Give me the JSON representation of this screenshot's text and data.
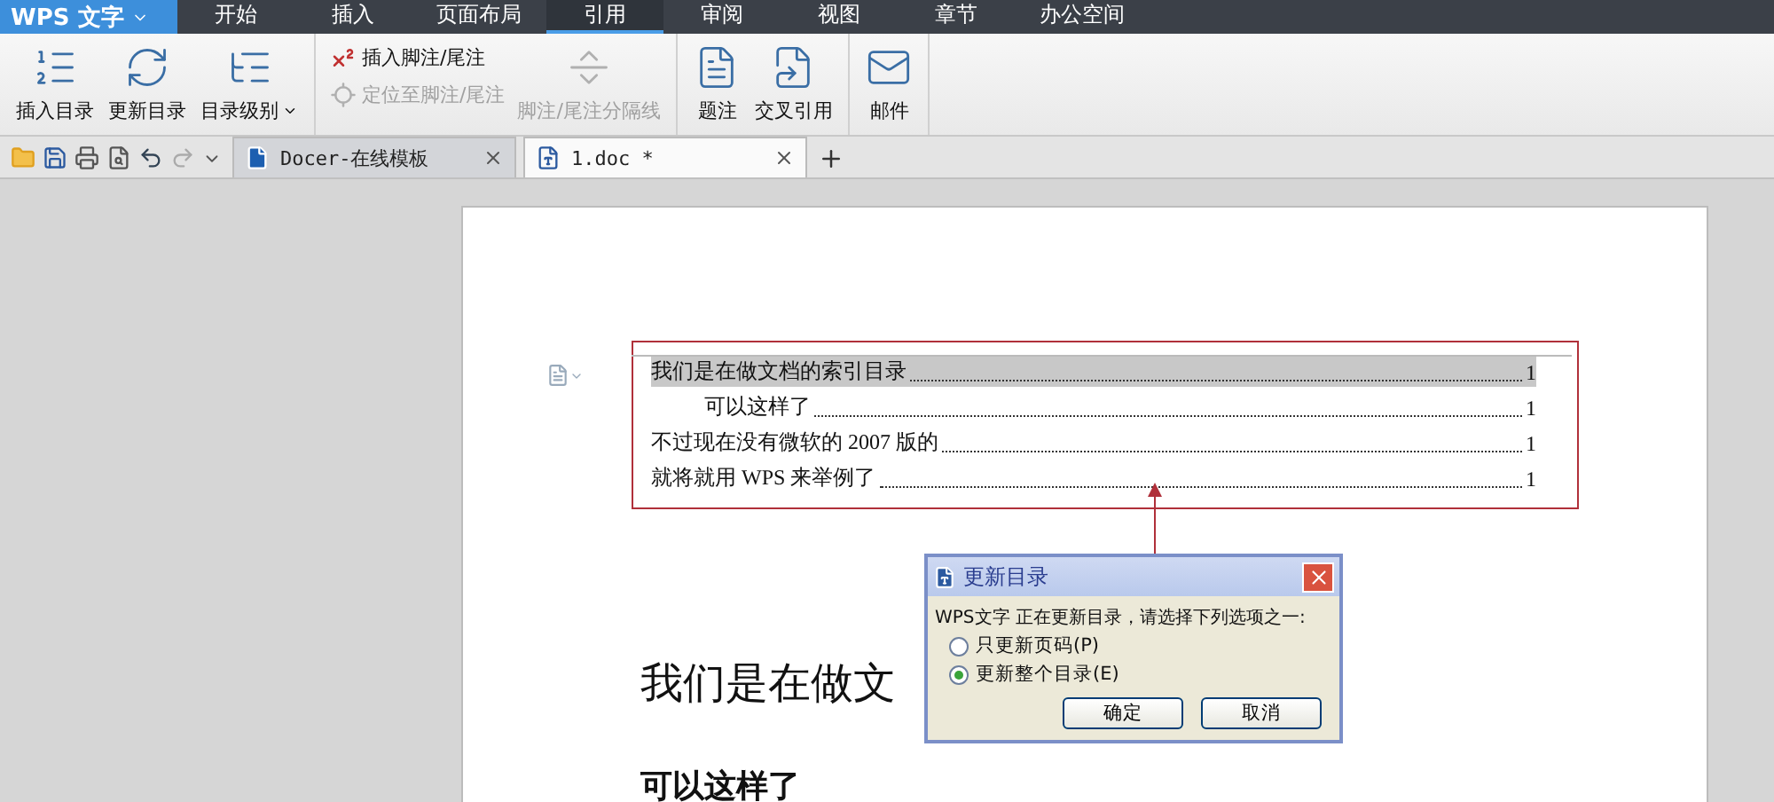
{
  "app_menu": {
    "title": "WPS 文字"
  },
  "menu_tabs": [
    {
      "label": "开始",
      "selected": false
    },
    {
      "label": "插入",
      "selected": false
    },
    {
      "label": "页面布局",
      "selected": false
    },
    {
      "label": "引用",
      "selected": true
    },
    {
      "label": "审阅",
      "selected": false
    },
    {
      "label": "视图",
      "selected": false
    },
    {
      "label": "章节",
      "selected": false
    },
    {
      "label": "办公空间",
      "selected": false
    }
  ],
  "ribbon_groups": [
    {
      "items": [
        {
          "kind": "large",
          "label": "插入目录",
          "disabled": false,
          "dropdown": false
        },
        {
          "kind": "large",
          "label": "更新目录",
          "disabled": false,
          "dropdown": false
        },
        {
          "kind": "large",
          "label": "目录级别",
          "disabled": false,
          "dropdown": true
        }
      ]
    },
    {
      "items": [
        {
          "kind": "small",
          "label": "插入脚注/尾注",
          "disabled": false,
          "dropdown": false
        },
        {
          "kind": "small",
          "label": "定位至脚注/尾注",
          "disabled": true,
          "dropdown": false
        },
        {
          "kind": "large",
          "label": "脚注/尾注分隔线",
          "disabled": true,
          "dropdown": false
        }
      ]
    },
    {
      "items": [
        {
          "kind": "large",
          "label": "题注",
          "disabled": false,
          "dropdown": false
        },
        {
          "kind": "large",
          "label": "交叉引用",
          "disabled": false,
          "dropdown": false
        }
      ]
    },
    {
      "items": [
        {
          "kind": "large",
          "label": "邮件",
          "disabled": false,
          "dropdown": false
        }
      ]
    }
  ],
  "doc_tabs": [
    {
      "label": "Docer-在线模板",
      "selected": false
    },
    {
      "label": "1.doc *",
      "selected": true
    }
  ],
  "toc": [
    {
      "text": "我们是在做文档的索引目录",
      "page": "1",
      "highlighted": true,
      "children": [
        {
          "text": "可以这样了",
          "page": "1",
          "highlighted": false
        }
      ]
    },
    {
      "text": "不过现在没有微软的 2007 版的",
      "page": "1",
      "highlighted": false
    },
    {
      "text": "就将就用 WPS 来举例了",
      "page": "1",
      "highlighted": false
    }
  ],
  "body_headings": [
    "我们是在做文",
    "可以这样了"
  ],
  "dialog": {
    "title": "更新目录",
    "message": "WPS文字 正在更新目录，请选择下列选项之一:",
    "options": [
      {
        "label": "只更新页码(P)",
        "selected": false
      },
      {
        "label": "更新整个目录(E)",
        "selected": true
      }
    ],
    "buttons": [
      "确定",
      "取消"
    ]
  }
}
